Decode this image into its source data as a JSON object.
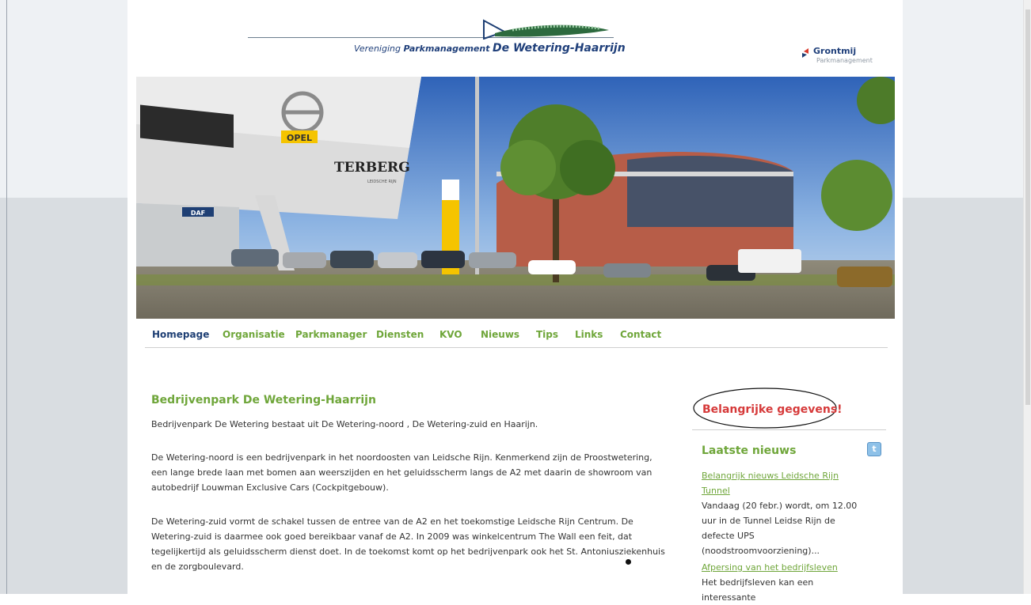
{
  "header": {
    "logo_prefix": "Vereniging",
    "logo_mid": "Parkmanagement",
    "logo_main": "De Wetering-Haarrijn",
    "partner_name": "Grontmij",
    "partner_sub": "Parkmanagement"
  },
  "hero": {
    "brand_opel": "OPEL",
    "brand_terberg": "TERBERG",
    "terberg_sub": "LEIDSCHE RIJN",
    "brand_daf": "DAF"
  },
  "nav": {
    "items": [
      {
        "label": "Homepage",
        "active": true
      },
      {
        "label": "Organisatie"
      },
      {
        "label": "Parkmanager"
      },
      {
        "label": "Diensten"
      },
      {
        "label": "KVO"
      },
      {
        "label": "Nieuws"
      },
      {
        "label": "Tips"
      },
      {
        "label": "Links"
      },
      {
        "label": "Contact"
      }
    ]
  },
  "content": {
    "title": "Bedrijvenpark De Wetering-Haarrijn",
    "paragraphs": [
      "Bedrijvenpark De Wetering bestaat uit De Wetering-noord , De Wetering-zuid en Haarijn.",
      "De Wetering-noord is een bedrijvenpark in het noordoosten van Leidsche Rijn. Kenmerkend zijn de Proostwetering, een lange brede laan met bomen aan weerszijden en het geluidsscherm langs de A2 met daarin de showroom van autobedrijf Louwman Exclusive Cars (Cockpitgebouw).",
      "De Wetering-zuid vormt de schakel tussen de entree van de A2 en het toekomstige Leidsche Rijn Centrum. De Wetering-zuid is daarmee ook goed bereikbaar vanaf de A2. In 2009 was winkelcentrum The Wall een feit, dat tegelijkertijd als geluidsscherm dienst doet. In de toekomst komt op het bedrijvenpark ook het St. Antoniusziekenhuis en de zorgboulevard."
    ]
  },
  "sidebar": {
    "important_label": "Belangrijke gegevens!",
    "news_title": "Laatste nieuws",
    "twitter_icon": "t",
    "news": [
      {
        "link": "Belangrijk nieuws Leidsche Rijn Tunnel",
        "text": "Vandaag (20 febr.) wordt, om 12.00 uur in de Tunnel Leidse Rijn de defecte UPS (noodstroomvoorziening)..."
      },
      {
        "link": "Afpersing van het bedrijfsleven",
        "text": "Het bedrijfsleven kan een interessante"
      }
    ]
  },
  "colors": {
    "accent_green": "#6fa63a",
    "navy": "#1e3f74",
    "alert_red": "#d63a3a"
  }
}
